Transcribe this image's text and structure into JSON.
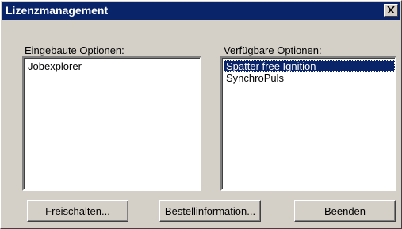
{
  "window": {
    "title": "Lizenzmanagement"
  },
  "installed": {
    "label": "Eingebaute Optionen:",
    "items": [
      "Jobexplorer"
    ]
  },
  "available": {
    "label": "Verfügbare Optionen:",
    "items": [
      "Spatter free Ignition",
      "SynchroPuls"
    ],
    "selected_item": "Spatter free Ignition"
  },
  "buttons": {
    "unlock": "Freischalten...",
    "order_info": "Bestellinformation...",
    "quit": "Beenden"
  },
  "colors": {
    "titlebar": "#0a246a",
    "face": "#d4d0c8",
    "selection": "#0a246a"
  }
}
